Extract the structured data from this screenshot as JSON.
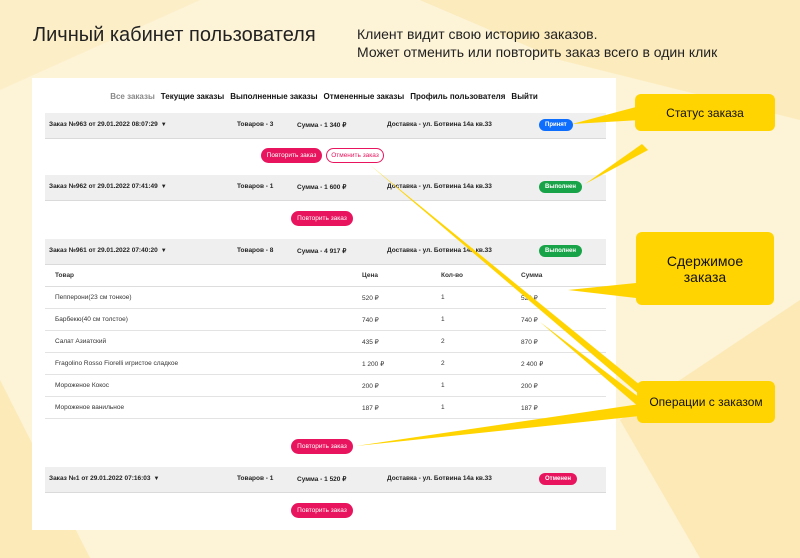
{
  "slide": {
    "title": "Личный кабинет пользователя",
    "desc_line1": "Клиент видит свою историю заказов.",
    "desc_line2": "Может отменить или повторить заказ всего в один клик"
  },
  "nav": {
    "all": "Все заказы",
    "current": "Текущие заказы",
    "done": "Выполненные заказы",
    "cancelled": "Отмененные заказы",
    "profile": "Профиль пользователя",
    "logout": "Выйти"
  },
  "orders": [
    {
      "title": "Заказ №963 от 29.01.2022 08:07:29",
      "items": "Товаров - 3",
      "sum": "Сумма - 1 340 ₽",
      "delivery": "Доставка - ул. Ботвина 14а кв.33",
      "status": "Принят"
    },
    {
      "title": "Заказ №962 от 29.01.2022 07:41:49",
      "items": "Товаров - 1",
      "sum": "Сумма - 1 600 ₽",
      "delivery": "Доставка - ул. Ботвина 14а кв.33",
      "status": "Выполнен"
    },
    {
      "title": "Заказ №961 от 29.01.2022 07:40:20",
      "items": "Товаров - 8",
      "sum": "Сумма - 4 917 ₽",
      "delivery": "Доставка - ул. Ботвина 14а кв.33",
      "status": "Выполнен"
    },
    {
      "title": "Заказ №1 от 29.01.2022 07:16:03",
      "items": "Товаров - 1",
      "sum": "Сумма - 1 520 ₽",
      "delivery": "Доставка - ул. Ботвина 14а кв.33",
      "status": "Отменен"
    }
  ],
  "buttons": {
    "repeat": "Повторить заказ",
    "cancel": "Отменить заказ"
  },
  "table": {
    "headers": [
      "Товар",
      "Цена",
      "Кол-во",
      "Сумма"
    ],
    "rows": [
      [
        "Пепперони(23 см тонкое)",
        "520 ₽",
        "1",
        "520 ₽"
      ],
      [
        "Барбекю(40 см толстое)",
        "740 ₽",
        "1",
        "740 ₽"
      ],
      [
        "Салат Азиатский",
        "435 ₽",
        "2",
        "870 ₽"
      ],
      [
        "Fragolino Rosso Fiorelli игристое сладкое",
        "1 200 ₽",
        "2",
        "2 400 ₽"
      ],
      [
        "Мороженое Кокос",
        "200 ₽",
        "1",
        "200 ₽"
      ],
      [
        "Мороженое ванильное",
        "187 ₽",
        "1",
        "187 ₽"
      ]
    ]
  },
  "callouts": {
    "status": "Статус заказа",
    "content_l1": "Сдержимое",
    "content_l2": "заказа",
    "operations": "Операции с заказом"
  },
  "colors": {
    "accent": "#e8155e",
    "accepted": "#0d6efd",
    "done": "#19a348",
    "callout": "#ffd400",
    "background": "#fdf3d6"
  }
}
